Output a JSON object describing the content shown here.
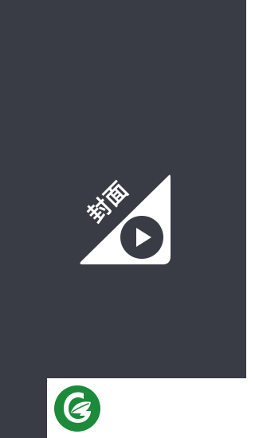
{
  "splash": {
    "background_color": "#3a3c45",
    "cover_label": "封面",
    "cover_icon": "play-icon"
  },
  "footer": {
    "background_color": "#ffffff",
    "brand_logo": {
      "icon": "green-g-leaf-logo",
      "color": "#1c8a3a"
    }
  }
}
